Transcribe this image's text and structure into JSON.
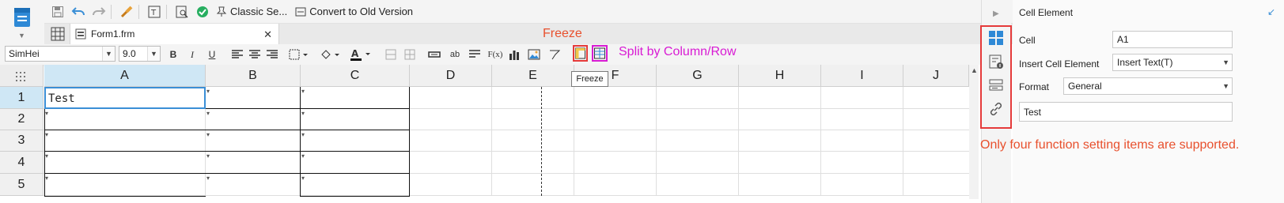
{
  "toolbar": {
    "classic_label": "Classic Se...",
    "convert_label": "Convert to Old Version"
  },
  "tabs": [
    {
      "label": "Form1.frm",
      "close": "✕"
    }
  ],
  "annotations": {
    "freeze_note": "Freeze",
    "split_note": "Split by Column/Row",
    "side_note": "Only four function setting items are supported."
  },
  "format_bar": {
    "font": "SimHei",
    "size": "9.0",
    "bold": "B",
    "italic": "I",
    "underline": "U",
    "text_label": "ab",
    "formula_label": "F(x)"
  },
  "tooltip": "Freeze",
  "grid": {
    "columns": [
      "A",
      "B",
      "C",
      "D",
      "E",
      "F",
      "G",
      "H",
      "I",
      "J"
    ],
    "rows": [
      "1",
      "2",
      "3",
      "4",
      "5"
    ],
    "active_column": "A",
    "active_row": "1",
    "a1_value": "Test"
  },
  "panel": {
    "title": "Cell Element",
    "cell_label": "Cell",
    "cell_value": "A1",
    "insert_label": "Insert Cell Element",
    "insert_value": "Insert Text(T)",
    "format_label": "Format",
    "format_value": "General",
    "content_value": "Test"
  },
  "colors": {
    "annotation_red": "#e8502d",
    "annotation_magenta": "#d81bd3",
    "selection_blue": "#3b8fd6",
    "highlight_header": "#cfe7f5"
  }
}
